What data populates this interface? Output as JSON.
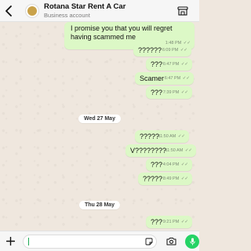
{
  "header": {
    "back_icon": "chevron-left-icon",
    "title": "Rotana Star Rent A Car",
    "subtitle": "Business account",
    "store_icon": "storefront-icon"
  },
  "messages": [
    {
      "text": "I promise you that you will regret having scammed me",
      "time": "1:48 PM",
      "status": "read"
    },
    {
      "text": "??????",
      "time": "6:09 PM",
      "status": "read"
    },
    {
      "text": "???",
      "time": "6:47 PM",
      "status": "read"
    },
    {
      "text": "Scamer",
      "time": "6:47 PM",
      "status": "read"
    },
    {
      "text": "???",
      "time": "7:39 PM",
      "status": "read"
    }
  ],
  "dates": [
    {
      "label": "Wed 27 May"
    },
    {
      "label": "Thu 28 May"
    }
  ],
  "messages2": [
    {
      "text": "?????",
      "time": "11:50 AM",
      "status": "read"
    },
    {
      "text": "V????????",
      "time": "11:50 AM",
      "status": "read"
    },
    {
      "text": "???",
      "time": "4:04 PM",
      "status": "read"
    },
    {
      "text": "?????",
      "time": "8:49 PM",
      "status": "read"
    }
  ],
  "messages3": [
    {
      "text": "???",
      "time": "9:21 PM",
      "status": "read"
    }
  ],
  "input": {
    "value": "",
    "placeholder": ""
  },
  "colors": {
    "outgoing_bubble": "#dcf8c6",
    "chat_background": "#efe7de",
    "accent": "#25d366"
  }
}
